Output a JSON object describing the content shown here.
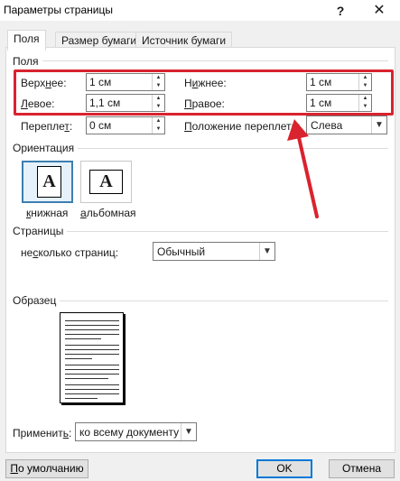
{
  "window": {
    "title": "Параметры страницы",
    "help_glyph": "?",
    "close_glyph": "✕"
  },
  "tabs": [
    {
      "label": "Поля",
      "active": true
    },
    {
      "label": "Размер бумаги",
      "active": false
    },
    {
      "label": "Источник бумаги",
      "active": false
    }
  ],
  "margins": {
    "section_label": "Поля",
    "top": {
      "label_pre": "Верх",
      "label_acc": "н",
      "label_post": "ее:",
      "value": "1 см"
    },
    "bottom": {
      "label_pre": "Н",
      "label_acc": "и",
      "label_post": "жнее:",
      "value": "1 см"
    },
    "left": {
      "label_pre": "",
      "label_acc": "Л",
      "label_post": "евое:",
      "value": "1,1 см"
    },
    "right": {
      "label_pre": "",
      "label_acc": "П",
      "label_post": "равое:",
      "value": "1 см"
    },
    "gutter": {
      "label_pre": "Перепле",
      "label_acc": "т",
      "label_post": ":",
      "value": "0 см"
    },
    "gutter_position": {
      "label_pre": "",
      "label_acc": "П",
      "label_post": "оложение переплета:",
      "value": "Слева"
    }
  },
  "orientation": {
    "section_label": "Ориентация",
    "portrait": {
      "label_pre": "",
      "label_acc": "к",
      "label_post": "нижная",
      "glyph": "A",
      "selected": true
    },
    "landscape": {
      "label_pre": "",
      "label_acc": "а",
      "label_post": "льбомная",
      "glyph": "A",
      "selected": false
    }
  },
  "pages": {
    "section_label": "Страницы",
    "multiple_label_pre": "не",
    "multiple_label_acc": "с",
    "multiple_label_post": "колько страниц:",
    "multiple_value": "Обычный"
  },
  "preview": {
    "section_label": "Образец"
  },
  "apply": {
    "label_pre": "Применит",
    "label_acc": "ь",
    "label_post": ":",
    "value": "ко всему документу"
  },
  "buttons": {
    "default_label_pre": "",
    "default_label_acc": "П",
    "default_label_post": "о умолчанию",
    "ok_label": "OK",
    "cancel_label": "Отмена"
  },
  "icons": {
    "spin_up": "▲",
    "spin_down": "▼",
    "dropdown": "▼"
  },
  "colors": {
    "annotation": "#d9232e",
    "accent": "#0078d7",
    "selected_border": "#3c7fb1"
  }
}
